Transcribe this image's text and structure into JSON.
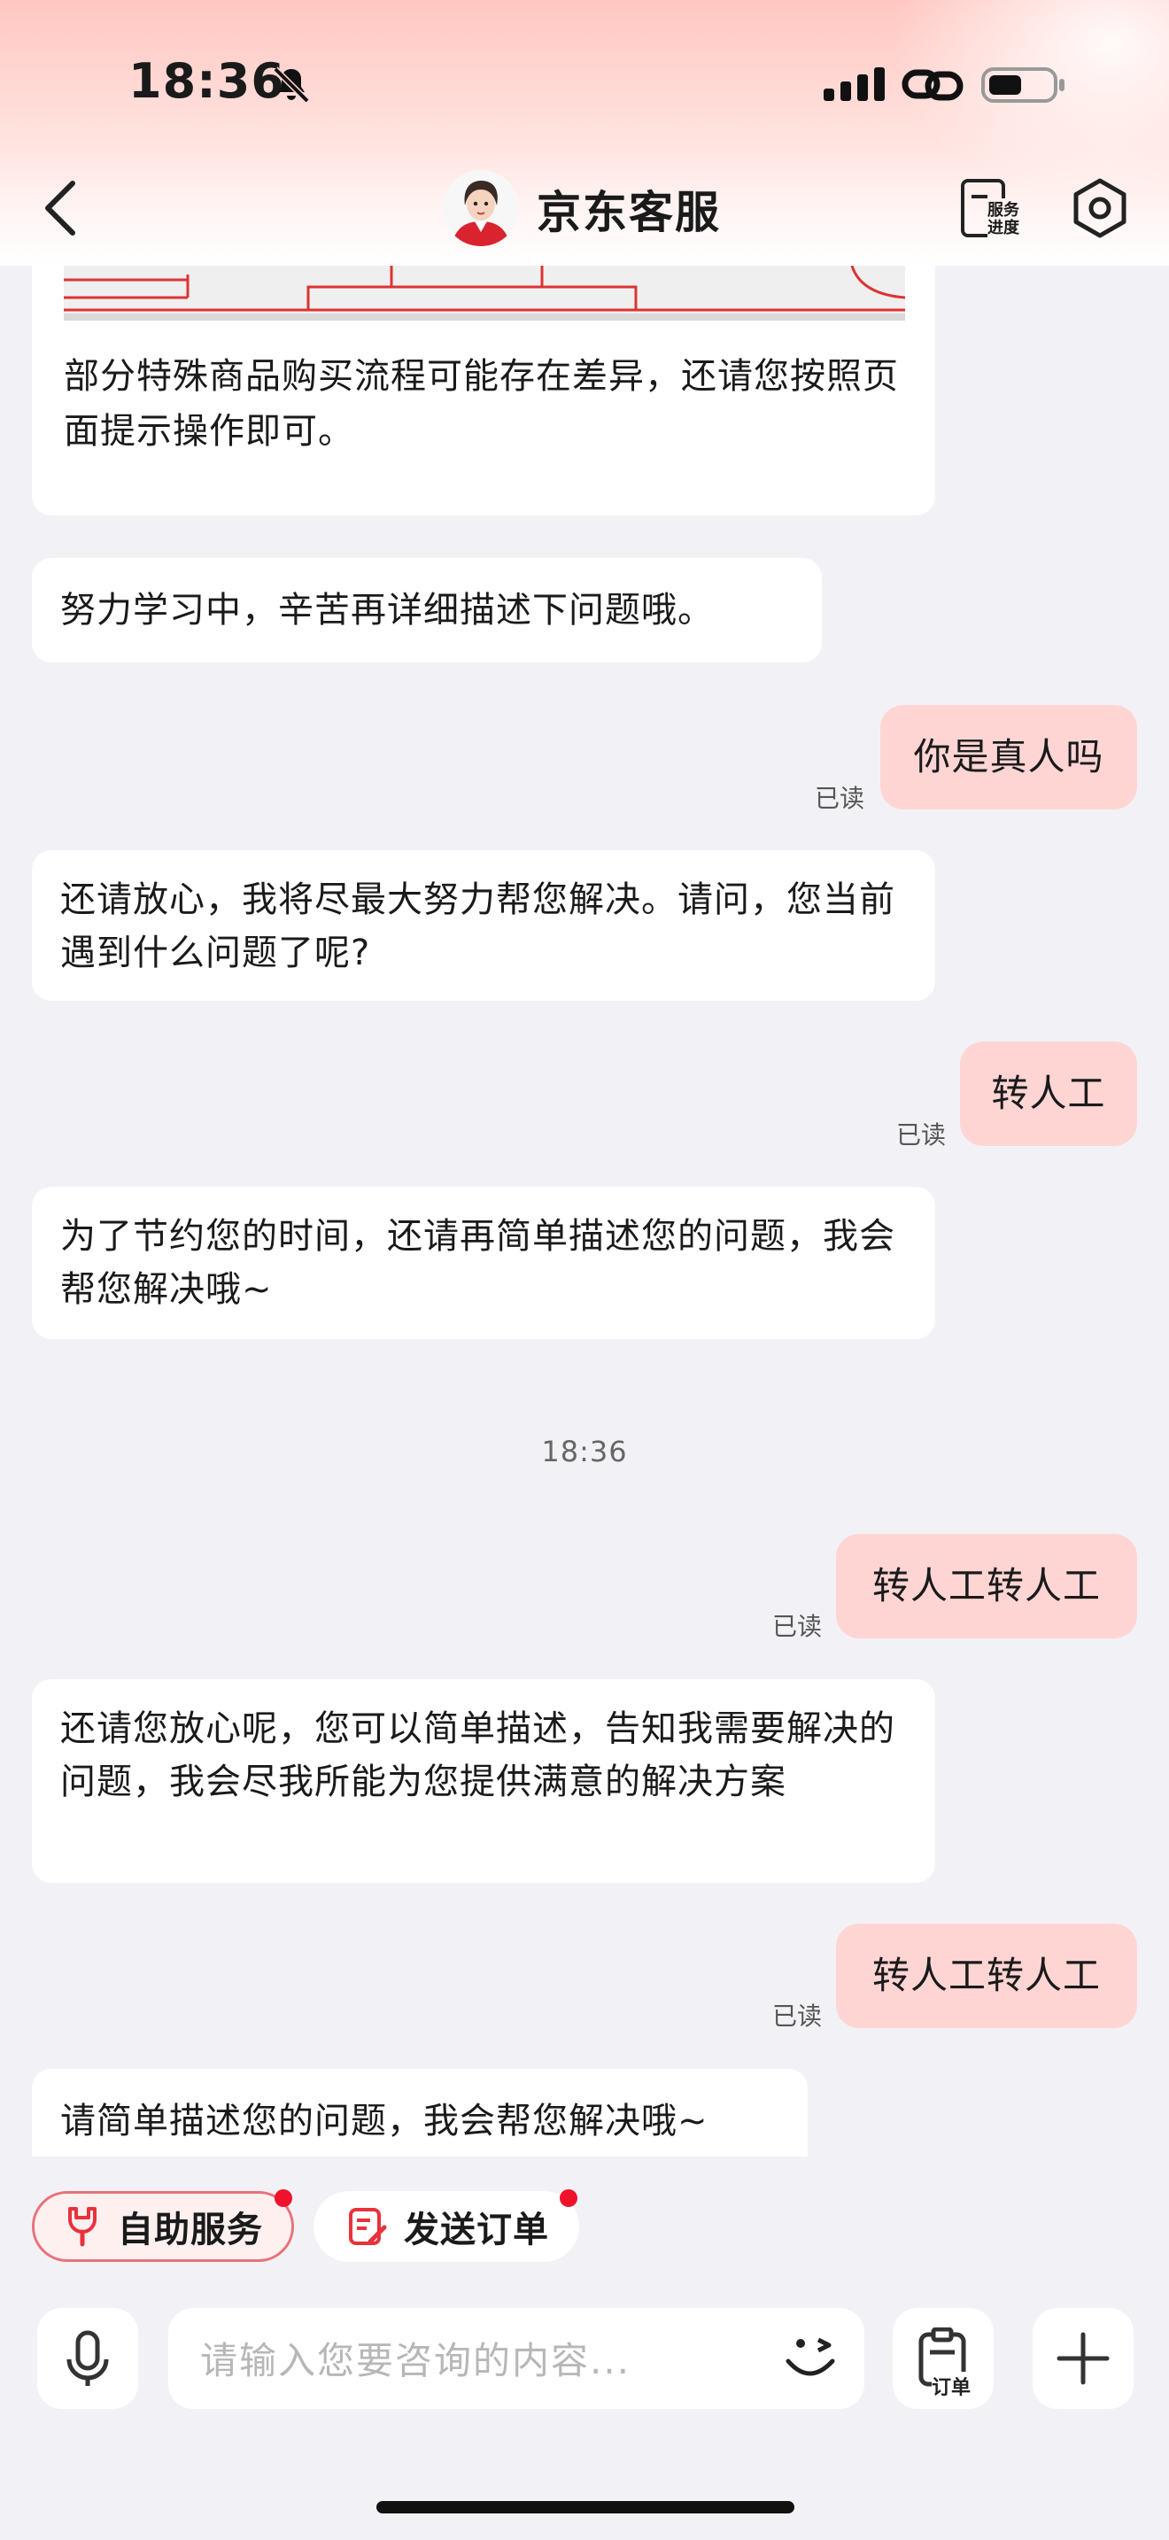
{
  "status_bar": {
    "time": "18:36"
  },
  "header": {
    "title": "京东客服",
    "progress_label_line1": "服务",
    "progress_label_line2": "进度"
  },
  "messages": [
    {
      "side": "left",
      "text": "部分特殊商品购买流程可能存在差异，还请您按照页面提示操作即可。"
    },
    {
      "side": "left",
      "text": "努力学习中，辛苦再详细描述下问题哦。"
    },
    {
      "side": "right",
      "text": "你是真人吗",
      "status": "已读"
    },
    {
      "side": "left",
      "text": "还请放心，我将尽最大努力帮您解决。请问，您当前遇到什么问题了呢?"
    },
    {
      "side": "right",
      "text": "转人工",
      "status": "已读"
    },
    {
      "side": "left",
      "text": "为了节约您的时间，还请再简单描述您的问题，我会帮您解决哦~"
    },
    {
      "side": "time",
      "text": "18:36"
    },
    {
      "side": "right",
      "text": "转人工转人工",
      "status": "已读"
    },
    {
      "side": "left",
      "text": "还请您放心呢，您可以简单描述，告知我需要解决的问题，我会尽我所能为您提供满意的解决方案"
    },
    {
      "side": "right",
      "text": "转人工转人工",
      "status": "已读"
    },
    {
      "side": "left",
      "text": "请简单描述您的问题，我会帮您解决哦~"
    }
  ],
  "quick_actions": [
    {
      "label": "自助服务"
    },
    {
      "label": "发送订单"
    }
  ],
  "input": {
    "placeholder": "请输入您要咨询的内容...",
    "order_label": "订单"
  },
  "colors": {
    "accent": "#e8323c",
    "bubble_right": "#ffd5d4",
    "dot": "#f0112c"
  }
}
